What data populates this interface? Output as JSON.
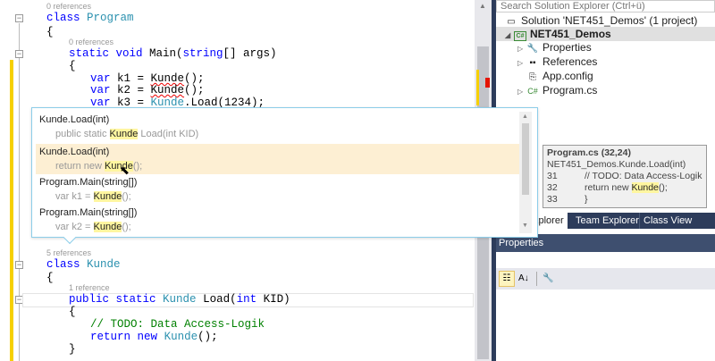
{
  "editor": {
    "lines": {
      "ref1": "0 references",
      "class_kw": "class",
      "class_name": "Program",
      "brace_open": "{",
      "ref2": "0 references",
      "main_sig_kw": "static void",
      "main_name": " Main(",
      "main_string": "string",
      "main_args": "[] args)",
      "var": "var",
      "k1": " k1 = ",
      "k2": " k2 = ",
      "k3": " k3 = ",
      "kunde": "Kunde",
      "call_end": "();",
      "load": ".Load(1234);",
      "ref3": "5 references",
      "class_kunde_name": "Kunde",
      "ref4": "1 reference",
      "public_static": "public static",
      "load_sig": " Load(",
      "int": "int",
      "kid": " KID)",
      "comment": "// TODO: Data Access-Logik",
      "return": "return",
      "new": "new",
      "brace_close": "}"
    }
  },
  "popup": {
    "items": [
      {
        "title": "Kunde.Load(int)",
        "pre": "public static ",
        "hit": "Kunde",
        "post": " Load(int KID)"
      },
      {
        "title": "Kunde.Load(int)",
        "pre": "return new ",
        "hit": "Kunde",
        "post": "();"
      },
      {
        "title": "Program.Main(string[])",
        "pre": "var k1 = ",
        "hit": "Kunde",
        "post": "();"
      },
      {
        "title": "Program.Main(string[])",
        "pre": "var k2 = ",
        "hit": "Kunde",
        "post": "();"
      }
    ]
  },
  "solution_explorer": {
    "search_placeholder": "Search Solution Explorer (Ctrl+ü)",
    "solution": "Solution 'NET451_Demos' (1 project)",
    "project": "NET451_Demos",
    "items": [
      "Properties",
      "References",
      "App.config",
      "Program.cs"
    ]
  },
  "tooltip": {
    "title": "Program.cs (32,24)",
    "member": "NET451_Demos.Kunde.Load(int)",
    "lines": [
      {
        "num": "31",
        "text": "// TODO: Data Access-Logik"
      },
      {
        "num": "32",
        "pre": "return new ",
        "hit": "Kunde",
        "post": "();"
      },
      {
        "num": "33",
        "text": "}"
      }
    ]
  },
  "tabs": [
    "xplorer",
    "Team Explorer",
    "Class View"
  ],
  "properties": {
    "title": "Properties"
  },
  "colors": {
    "accent": "#2d3c5b",
    "highlight": "#fff6a0",
    "selected_row": "#fdefd3"
  }
}
